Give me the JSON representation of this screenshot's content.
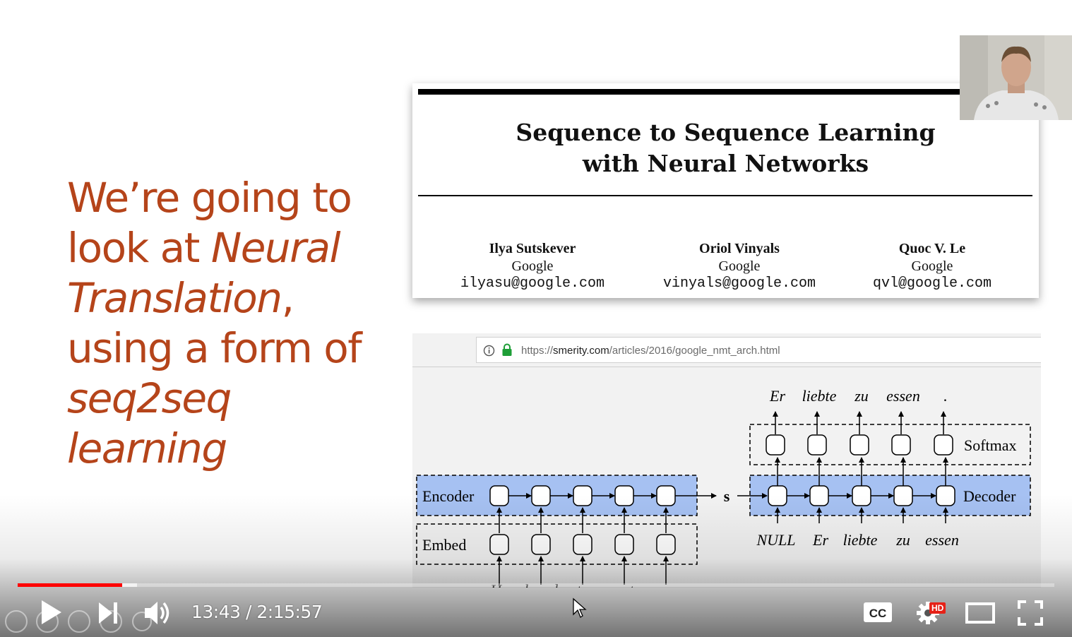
{
  "slide": {
    "heading_lines": [
      {
        "text": "We’re going to",
        "italic": false
      },
      {
        "prefix": "look at ",
        "emph": "Neural"
      },
      {
        "emph": "Translation",
        "suffix": ","
      },
      {
        "text": "using a form of",
        "italic": false
      },
      {
        "text": "seq2seq",
        "italic": true
      },
      {
        "text": "learning",
        "italic": true
      }
    ],
    "accent_color": "#b5441a"
  },
  "paper": {
    "title_line1": "Sequence to Sequence Learning",
    "title_line2": "with Neural Networks",
    "authors": [
      {
        "name": "Ilya Sutskever",
        "org": "Google",
        "email": "ilyasu@google.com"
      },
      {
        "name": "Oriol Vinyals",
        "org": "Google",
        "email": "vinyals@google.com"
      },
      {
        "name": "Quoc V. Le",
        "org": "Google",
        "email": "qvl@google.com"
      }
    ]
  },
  "browser": {
    "url_prefix": "https://",
    "url_domain": "smerity.com",
    "url_path": "/articles/2016/google_nmt_arch.html",
    "info_icon": "info-icon",
    "lock_icon": "lock-icon",
    "lock_color": "#1e9e37"
  },
  "diagram": {
    "encoder_label": "Encoder",
    "embed_label": "Embed",
    "decoder_label": "Decoder",
    "softmax_label": "Softmax",
    "state_label": "s",
    "input_words": [
      "He",
      "loved",
      "to",
      "eat",
      "."
    ],
    "decoder_inputs": [
      "NULL",
      "Er",
      "liebte",
      "zu",
      "essen"
    ],
    "output_words": [
      "Er",
      "liebte",
      "zu",
      "essen",
      "."
    ],
    "layer_fill": "#a6c1f2"
  },
  "player": {
    "current_time": "13:43",
    "duration": "2:15:57",
    "time_display": "13:43 / 2:15:57",
    "progress_fraction": 0.101,
    "buffered_fraction": 0.115,
    "progress_color": "#ff0000",
    "hd_badge": "HD",
    "cc_label": "CC"
  }
}
